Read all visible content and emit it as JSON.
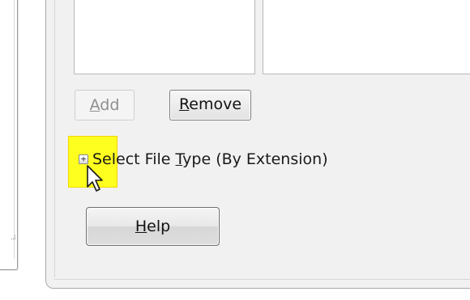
{
  "buttons": {
    "add": {
      "before": "",
      "mnemonic": "A",
      "after": "dd",
      "enabled": false
    },
    "remove": {
      "before": "",
      "mnemonic": "R",
      "after": "emove"
    },
    "help": {
      "before": "",
      "mnemonic": "H",
      "after": "elp"
    }
  },
  "file_type_section": {
    "toggle_symbol": "+",
    "label_before": "Select File ",
    "label_mnemonic": "T",
    "label_after": "ype (By Extension)",
    "expanded": false
  },
  "colors": {
    "highlight": "#ffff1f",
    "frame_background": "#f1f1f1",
    "disabled_text": "#8f8f8f"
  },
  "icons": {
    "toggle": "plus-box-icon",
    "cursor": "mouse-pointer-icon"
  }
}
